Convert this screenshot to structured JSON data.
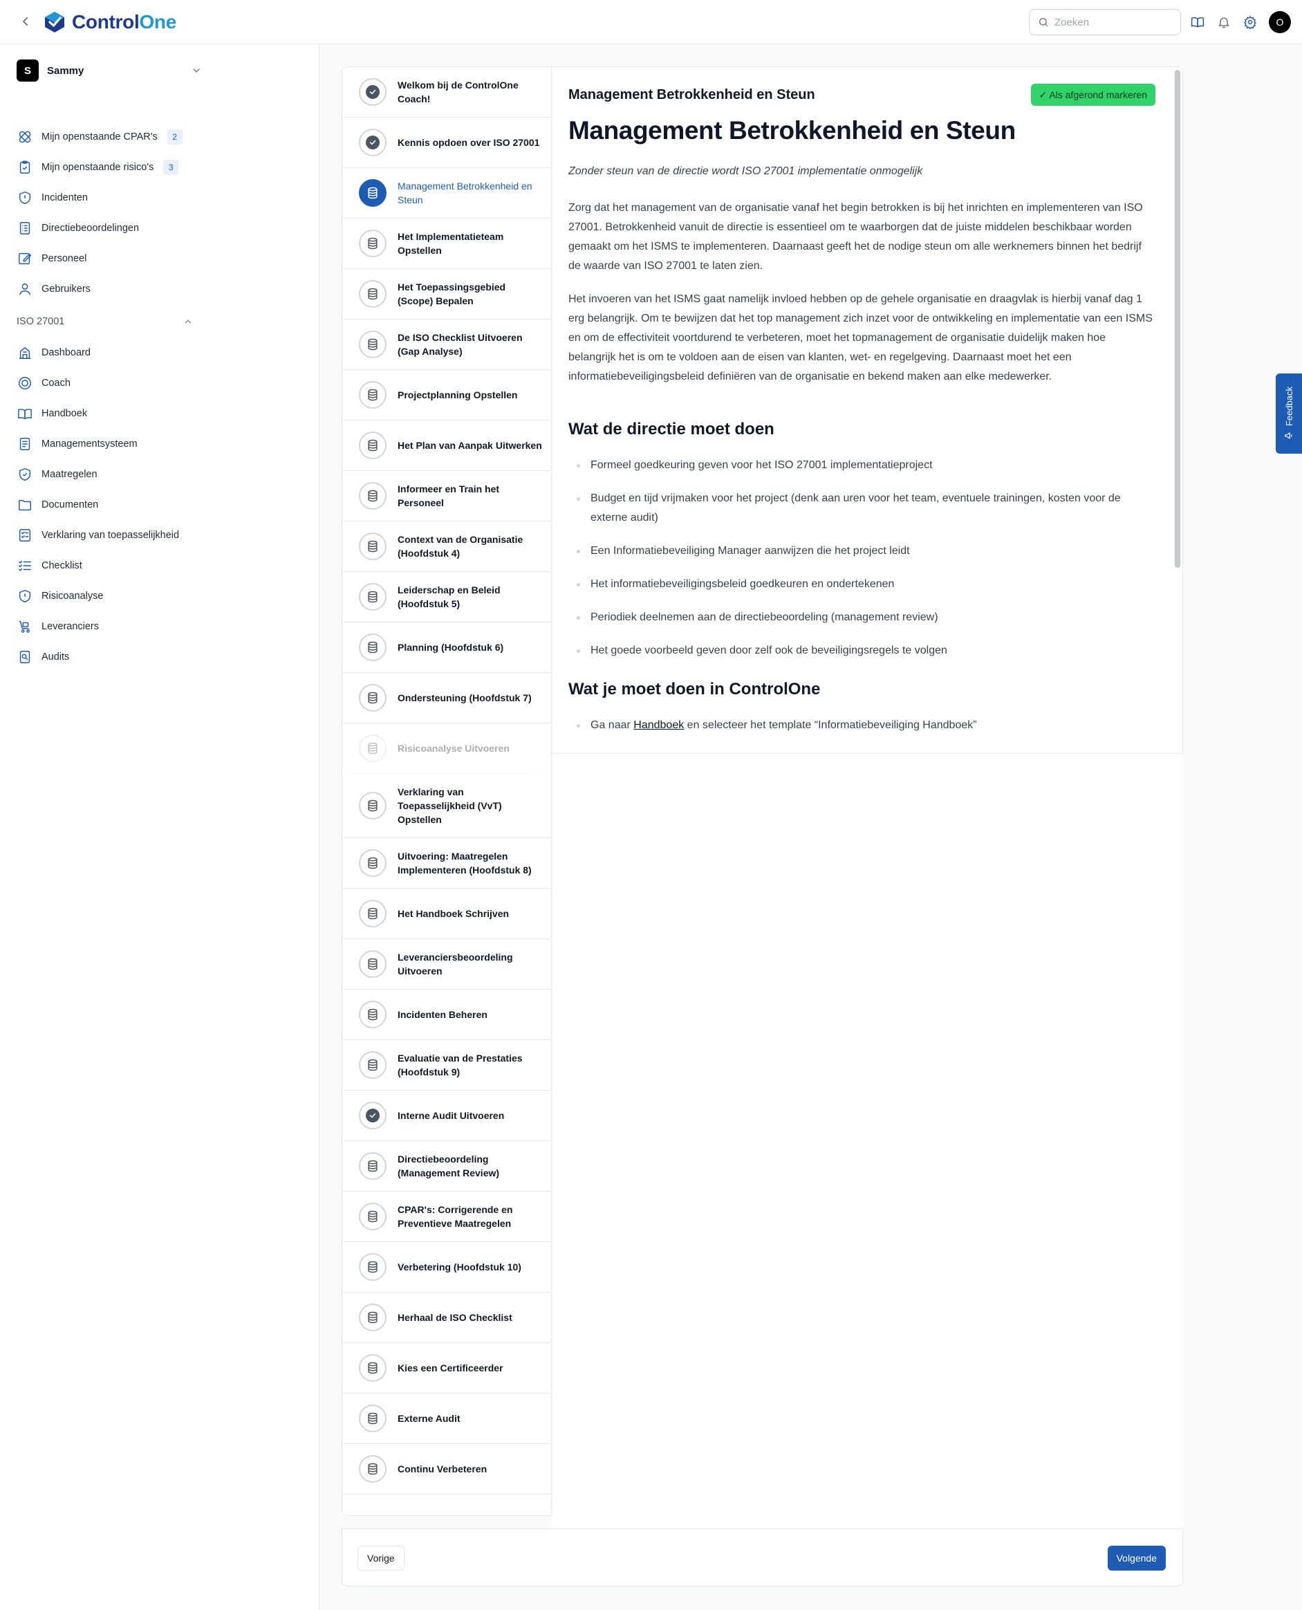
{
  "app": {
    "logo_part1": "Control",
    "logo_part2": "One",
    "search_placeholder": "Zoeken",
    "user_initial": "O",
    "brand_color": "#1e5bb5"
  },
  "sidebar": {
    "org_initial": "S",
    "org_name": "Sammy",
    "top_items": [
      {
        "label": "Mijn openstaande CPAR's",
        "badge": "2",
        "icon": "bandage-icon"
      },
      {
        "label": "Mijn openstaande risico's",
        "badge": "3",
        "icon": "clipboard-check-icon"
      },
      {
        "label": "Incidenten",
        "icon": "shield-alert-icon"
      },
      {
        "label": "Directiebeoordelingen",
        "icon": "list-icon"
      },
      {
        "label": "Personeel",
        "icon": "edit-icon"
      },
      {
        "label": "Gebruikers",
        "icon": "user-icon"
      }
    ],
    "section_title": "ISO 27001",
    "section_items": [
      {
        "label": "Dashboard",
        "icon": "building-icon"
      },
      {
        "label": "Coach",
        "icon": "target-icon"
      },
      {
        "label": "Handboek",
        "icon": "book-icon"
      },
      {
        "label": "Managementsysteem",
        "icon": "document-icon"
      },
      {
        "label": "Maatregelen",
        "icon": "shield-check-icon"
      },
      {
        "label": "Documenten",
        "icon": "folder-icon"
      },
      {
        "label": "Verklaring van toepasselijkheid",
        "icon": "checklist-doc-icon"
      },
      {
        "label": "Checklist",
        "icon": "checklist-icon"
      },
      {
        "label": "Risicoanalyse",
        "icon": "shield-exclamation-icon"
      },
      {
        "label": "Leveranciers",
        "icon": "truck-icon"
      },
      {
        "label": "Audits",
        "icon": "audit-icon"
      }
    ]
  },
  "steps": [
    {
      "title": "Welkom bij de ControlOne Coach!",
      "status": "done"
    },
    {
      "title": "Kennis opdoen over ISO 27001",
      "status": "done"
    },
    {
      "title": "Management Betrokkenheid en Steun",
      "status": "active"
    },
    {
      "title": "Het Implementatieteam Opstellen",
      "status": "todo"
    },
    {
      "title": "Het Toepassingsgebied (Scope) Bepalen",
      "status": "todo"
    },
    {
      "title": "De ISO Checklist Uitvoeren (Gap Analyse)",
      "status": "todo"
    },
    {
      "title": "Projectplanning Opstellen",
      "status": "todo"
    },
    {
      "title": "Het Plan van Aanpak Uitwerken",
      "status": "todo"
    },
    {
      "title": "Informeer en Train het Personeel",
      "status": "todo"
    },
    {
      "title": "Context van de Organisatie (Hoofdstuk 4)",
      "status": "todo"
    },
    {
      "title": "Leiderschap en Beleid (Hoofdstuk 5)",
      "status": "todo"
    },
    {
      "title": "Planning (Hoofdstuk 6)",
      "status": "todo"
    },
    {
      "title": "Ondersteuning (Hoofdstuk 7)",
      "status": "todo"
    },
    {
      "title": "Risicoanalyse Uitvoeren",
      "status": "faded"
    },
    {
      "title": "Verklaring van Toepasselijkheid (VvT) Opstellen",
      "status": "todo",
      "tall": true
    },
    {
      "title": "Uitvoering: Maatregelen Implementeren (Hoofdstuk 8)",
      "status": "todo"
    },
    {
      "title": "Het Handboek Schrijven",
      "status": "todo"
    },
    {
      "title": "Leveranciersbeoordeling Uitvoeren",
      "status": "todo"
    },
    {
      "title": "Incidenten Beheren",
      "status": "todo"
    },
    {
      "title": "Evaluatie van de Prestaties (Hoofdstuk 9)",
      "status": "todo"
    },
    {
      "title": "Interne Audit Uitvoeren",
      "status": "done"
    },
    {
      "title": "Directiebeoordeling (Management Review)",
      "status": "todo"
    },
    {
      "title": "CPAR's: Corrigerende en Preventieve Maatregelen",
      "status": "todo"
    },
    {
      "title": "Verbetering (Hoofdstuk 10)",
      "status": "todo"
    },
    {
      "title": "Herhaal de ISO Checklist",
      "status": "todo"
    },
    {
      "title": "Kies een Certificeerder",
      "status": "todo"
    },
    {
      "title": "Externe Audit",
      "status": "todo"
    },
    {
      "title": "Continu Verbeteren",
      "status": "todo"
    }
  ],
  "content": {
    "header_title": "Management Betrokkenheid en Steun",
    "mark_complete": "✓ Als afgerond markeren",
    "title": "Management Betrokkenheid en Steun",
    "lead": "Zonder steun van de directie wordt ISO 27001 implementatie onmogelijk",
    "p1": "Zorg dat het management van de organisatie vanaf het begin betrokken is bij het inrichten en implementeren van ISO 27001. Betrokkenheid vanuit de directie is essentieel om te waarborgen dat de juiste middelen beschikbaar worden gemaakt om het ISMS te implementeren. Daarnaast geeft het de nodige steun om alle werknemers binnen het bedrijf de waarde van ISO 27001 te laten zien.",
    "p2": "Het invoeren van het ISMS gaat namelijk invloed hebben op de gehele organisatie en draagvlak is hierbij vanaf dag 1 erg belangrijk. Om te bewijzen dat het top management zich inzet voor de ontwikkeling en implementatie van een ISMS en om de effectiviteit voortdurend te verbeteren, moet het topmanagement de organisatie duidelijk maken hoe belangrijk het is om te voldoen aan de eisen van klanten, wet- en regelgeving. Daarnaast moet het een informatiebeveiligingsbeleid definiëren van de organisatie en bekend maken aan elke medewerker.",
    "h2_directie": "Wat de directie moet doen",
    "directie_items": [
      "Formeel goedkeuring geven voor het ISO 27001 implementatieproject",
      "Budget en tijd vrijmaken voor het project (denk aan uren voor het team, eventuele trainingen, kosten voor de externe audit)",
      "Een Informatiebeveiliging Manager aanwijzen die het project leidt",
      "Het informatiebeveiligingsbeleid goedkeuren en ondertekenen",
      "Periodiek deelnemen aan de directiebeoordeling (management review)",
      "Het goede voorbeeld geven door zelf ook de beveiligingsregels te volgen"
    ],
    "h2_controlone": "Wat je moet doen in ControlOne",
    "co_item_pre": "Ga naar",
    "co_item_link": "Handboek",
    "co_item_post": "en selecteer het template “Informatiebeveiliging Handboek”"
  },
  "footer": {
    "prev": "Vorige",
    "next": "Volgende"
  },
  "feedback": {
    "label": "Feedback"
  }
}
